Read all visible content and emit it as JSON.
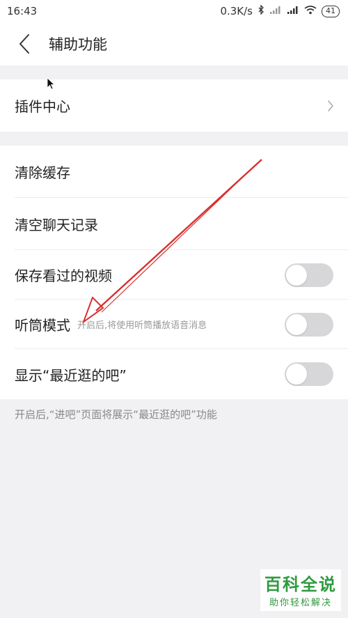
{
  "status_bar": {
    "time": "16:43",
    "network_speed": "0.3K/s",
    "battery": "41",
    "icons": [
      "bluetooth-icon",
      "signal-icon",
      "signal-icon",
      "wifi-icon",
      "battery-icon"
    ]
  },
  "header": {
    "back_icon": "chevron-left-icon",
    "title": "辅助功能"
  },
  "plugin_section": {
    "label": "插件中心",
    "icon": "chevron-right-icon"
  },
  "settings": {
    "clear_cache": "清除缓存",
    "clear_chat": "清空聊天记录",
    "save_videos": {
      "label": "保存看过的视频",
      "on": false
    },
    "earpiece": {
      "label": "听筒模式",
      "hint": "开启后,将使用听筒播放语音消息",
      "on": false
    },
    "show_recent": {
      "label": "显示“最近逛的吧”",
      "on": false
    }
  },
  "footnote": "开启后,“进吧”页面将展示“最近逛的吧”功能",
  "watermark": {
    "title": "百科全说",
    "subtitle": "助你轻松解决"
  },
  "colors": {
    "annotation_arrow": "#d93030",
    "toggle_off": "#d7d7d9",
    "watermark_green": "#2e9b3f"
  }
}
